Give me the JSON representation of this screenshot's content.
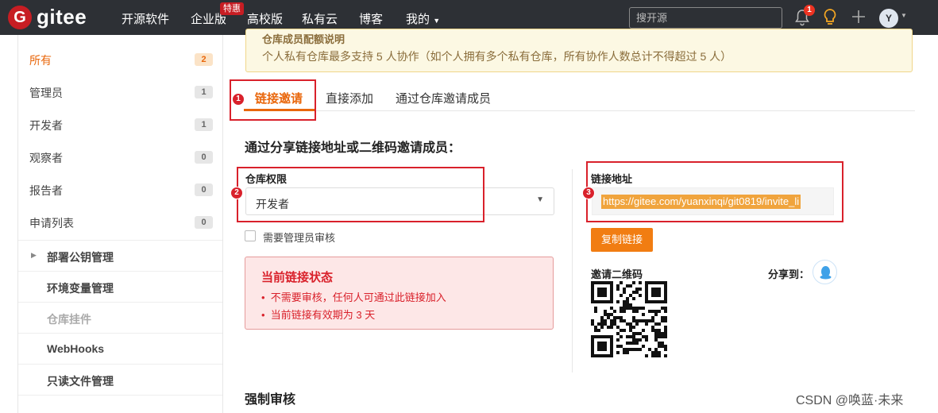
{
  "topnav": {
    "brand": "gitee",
    "logo_letter": "G",
    "items": [
      "开源软件",
      "企业版",
      "高校版",
      "私有云",
      "博客",
      "我的"
    ],
    "special_badge": "特惠",
    "search_placeholder": "搜开源",
    "notification_count": "1",
    "avatar_letter": "Y"
  },
  "sidebar": {
    "roles": [
      {
        "label": "所有",
        "count": "2"
      },
      {
        "label": "管理员",
        "count": "1"
      },
      {
        "label": "开发者",
        "count": "1"
      },
      {
        "label": "观察者",
        "count": "0"
      },
      {
        "label": "报告者",
        "count": "0"
      },
      {
        "label": "申请列表",
        "count": "0"
      }
    ],
    "subitems": [
      "部署公钥管理",
      "环境变量管理",
      "仓库挂件",
      "WebHooks",
      "只读文件管理"
    ]
  },
  "notice": {
    "cut_title": "仓库成员配额说明",
    "text": "个人私有仓库最多支持 5 人协作（如个人拥有多个私有仓库，所有协作人数总计不得超过 5 人）"
  },
  "tabs": [
    "链接邀请",
    "直接添加",
    "通过仓库邀请成员"
  ],
  "invite": {
    "heading": "通过分享链接地址或二维码邀请成员：",
    "permission_label": "仓库权限",
    "permission_value": "开发者",
    "require_review": "需要管理员审核",
    "status_title": "当前链接状态",
    "status_items": [
      "不需要审核，任何人可通过此链接加入",
      "当前链接有效期为 3 天"
    ],
    "link_label": "链接地址",
    "link_value": "https://gitee.com/yuanxinqi/git0819/invite_li",
    "copy_button": "复制链接",
    "qr_label": "邀请二维码",
    "share_label": "分享到："
  },
  "force_review_heading": "强制审核",
  "annotations": [
    "1",
    "2",
    "3"
  ],
  "watermark": "CSDN @唤蓝·未来",
  "colors": {
    "accent": "#e9670c",
    "nav_bg": "#2d3035",
    "highlight_box": "#d9212b"
  }
}
